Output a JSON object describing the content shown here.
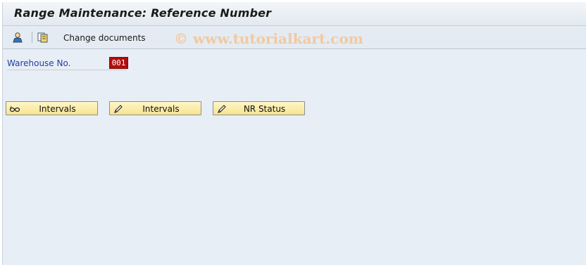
{
  "window": {
    "title": "Range Maintenance: Reference Number"
  },
  "toolbar": {
    "icons": [
      "user-icon",
      "copy-icon"
    ],
    "change_documents": "Change documents",
    "watermark": "© www.tutorialkart.com"
  },
  "form": {
    "warehouse_label": "Warehouse No.",
    "warehouse_value": "001"
  },
  "buttons": [
    {
      "label": "Intervals",
      "icon": "glasses-icon"
    },
    {
      "label": "Intervals",
      "icon": "pencil-icon"
    },
    {
      "label": "NR Status",
      "icon": "pencil-icon"
    }
  ],
  "colors": {
    "background": "#e8eef5",
    "label_blue": "#1f3fa6",
    "value_red": "#b20d0d",
    "button_yellow": "#f7e48e"
  }
}
